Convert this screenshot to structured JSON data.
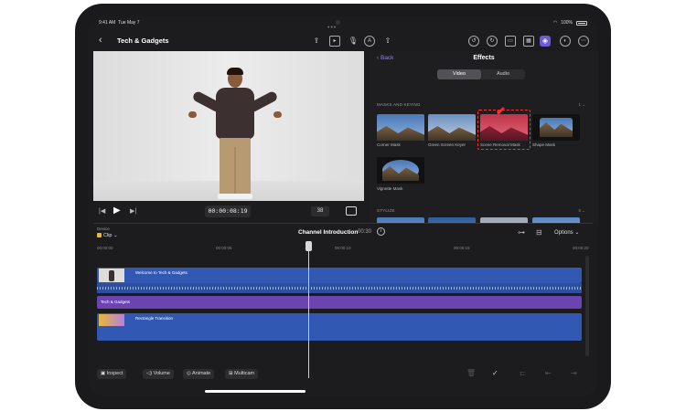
{
  "status": {
    "time": "9:41 AM",
    "date": "Tue May 7",
    "battery": "100%"
  },
  "header": {
    "back": "‹",
    "title": "Tech & Gadgets"
  },
  "viewer": {
    "timecode": "00:00:08:19",
    "zoom": "38"
  },
  "effects": {
    "back_label": "Back",
    "title": "Effects",
    "tabs": [
      "Video",
      "Audio"
    ],
    "active_tab": "Video",
    "masks_section": "MASKS AND KEYING",
    "masks_count": "1",
    "items": [
      "Corner Mask",
      "Green Screen Keyer",
      "Scene Removal Mask",
      "Shape Mask",
      "Vignette Mask"
    ],
    "selected": "Scene Removal Mask",
    "stylize_section": "STYLIZE",
    "stylize_count": "5"
  },
  "timeline": {
    "device_label": "Device",
    "clip_label": "Clip",
    "project_name": "Channel Introduction",
    "duration": "00:30",
    "options_label": "Options",
    "ruler": [
      "00:00:00",
      "00:00:05",
      "00:00:10",
      "00:00:15",
      "00:00:20"
    ],
    "tracks": [
      "Welcome to Tech & Gadgets",
      "Tech & Gadgets",
      "Rectangle Transition"
    ]
  },
  "toolbar": {
    "inspect": "Inspect",
    "volume": "Volume",
    "animate": "Animate",
    "multicam": "Multicam"
  },
  "colors": {
    "accent": "#6e5bd8",
    "video_track": "#3159b4",
    "title_track": "#6b44b0",
    "highlight": "#ff3030"
  }
}
